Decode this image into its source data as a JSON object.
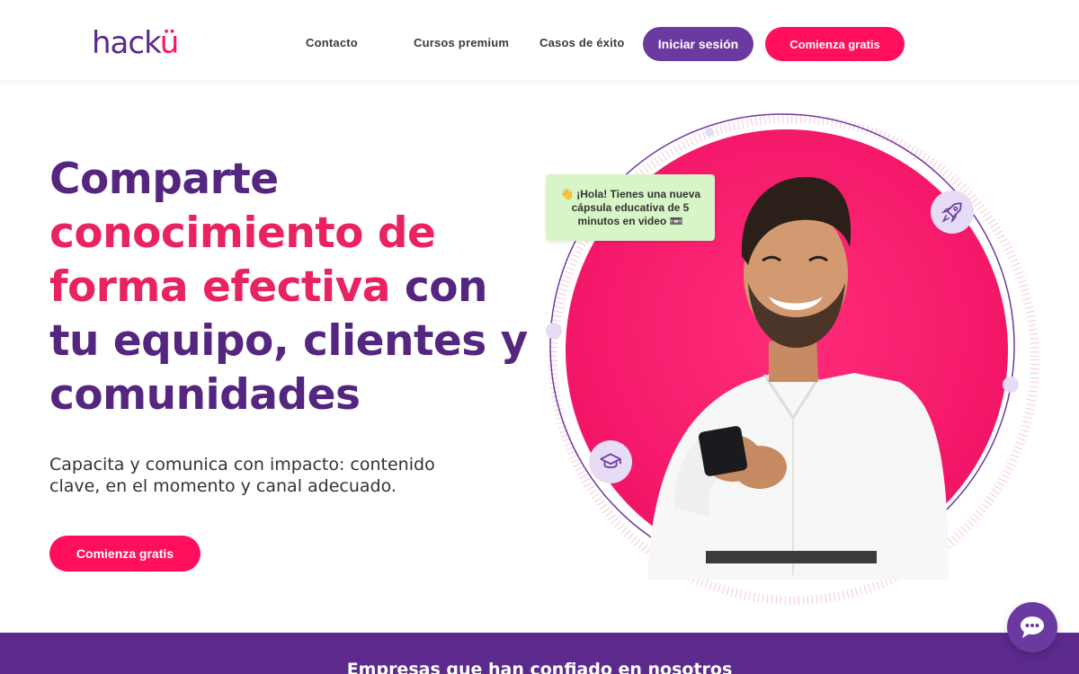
{
  "header": {
    "logo_text_main": "hack",
    "logo_text_accent": "ü",
    "nav": {
      "contact": "Contacto",
      "premium": "Cursos premium",
      "success": "Casos de éxito"
    },
    "login_label": "Iniciar sesión",
    "start_label": "Comienza gratis"
  },
  "hero": {
    "title_part1": "Comparte ",
    "title_part2_pink": "conocimiento de forma efectiva",
    "title_part3": " con tu equipo, clientes y comunidades",
    "subtitle": "Capacita y comunica con impacto: contenido clave, en el momento y canal adecuado.",
    "cta_label": "Comienza gratis"
  },
  "illustration": {
    "bubble_text": "👋 ¡Hola! Tienes una nueva cápsula educativa de 5 minutos en video 📼",
    "icons": [
      "rocket-icon",
      "graduation-cap-icon"
    ]
  },
  "band": {
    "title": "Empresas que han confiado en nosotros"
  },
  "chat": {
    "icon": "chat-bubble-icon"
  },
  "colors": {
    "brand_purple": "#5b2a8c",
    "button_purple": "#6b3aa0",
    "accent_pink": "#ff0f5c",
    "title_pink": "#e8235f",
    "bubble_green": "#d8f5c8"
  }
}
